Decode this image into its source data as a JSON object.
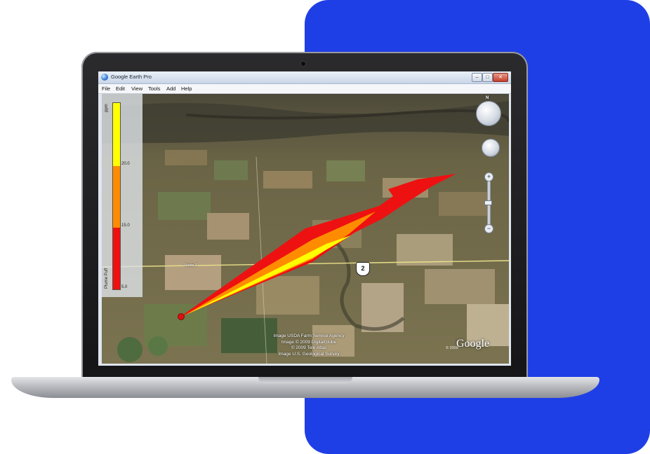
{
  "window": {
    "title": "Google Earth Pro",
    "controls": {
      "minimize": "–",
      "maximize": "□",
      "close": "✕"
    }
  },
  "menu": [
    "File",
    "Edit",
    "View",
    "Tools",
    "Add",
    "Help"
  ],
  "legend": {
    "unit": "ppm",
    "title": "Plume Puff",
    "ticks": [
      "20.0",
      "15.0",
      "5.0"
    ],
    "colors": [
      "#ffff00",
      "#ff8c00",
      "#ee1111"
    ]
  },
  "navigation": {
    "north_label": "N",
    "zoom_in": "+",
    "zoom_out": "−"
  },
  "map": {
    "route_shield": "2",
    "road_label": "Route 2",
    "credits": [
      "Image USDA Farm Service Agency",
      "Image © 2009 DigitalGlobe",
      "© 2009 Tele Atlas",
      "Image U.S. Geological Survey"
    ],
    "copyright": "© 2009",
    "logo": "Google",
    "plume_colors": {
      "inner": "#ffff00",
      "middle": "#ff8c00",
      "outer": "#ee1111"
    }
  },
  "page": {
    "panel_color": "#1f3fe6"
  }
}
